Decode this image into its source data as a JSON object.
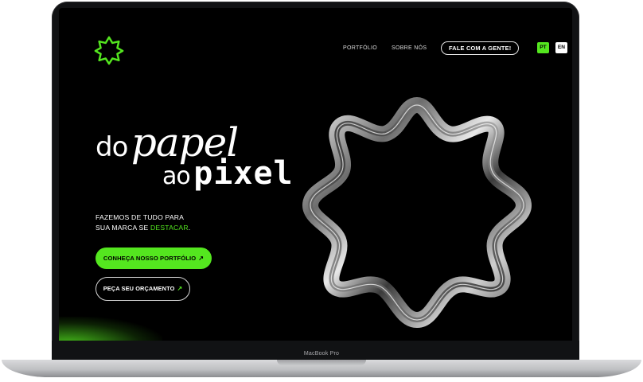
{
  "device": {
    "model_label": "MacBook Pro"
  },
  "nav": {
    "links": [
      "PORTFÓLIO",
      "SOBRE NÓS"
    ],
    "cta": "FALE COM A GENTE!",
    "languages": [
      "PT",
      "EN"
    ],
    "active_language": "PT"
  },
  "hero": {
    "line1_small": "do",
    "line1_big": "papel",
    "line2_small": "ao",
    "line2_big": "pixel",
    "tagline_line1": "FAZEMOS DE TUDO PARA",
    "tagline_line2_prefix": "SUA MARCA SE ",
    "tagline_highlight": "DESTACAR",
    "tagline_suffix": "."
  },
  "buttons": {
    "primary": "CONHEÇA NOSSO PORTFÓLIO",
    "secondary": "PEÇA SEU ORÇAMENTO"
  },
  "colors": {
    "accent": "#54e61f",
    "background": "#000000",
    "text": "#ffffff"
  },
  "icons": {
    "logo": "eight-point-star-outline-icon",
    "button_arrow": "arrow-up-right-icon",
    "hero_graphic": "chrome-eight-point-star-ring"
  }
}
